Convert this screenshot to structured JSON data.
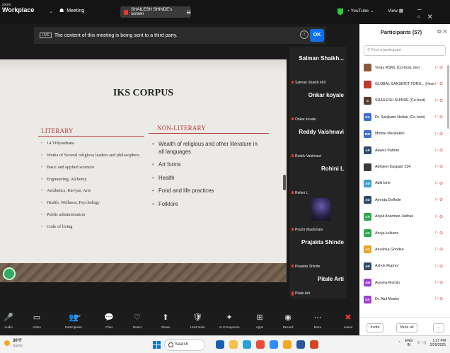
{
  "titlebar": {
    "logo_line1": "zoom",
    "logo_line2": "Workplace",
    "meeting_label": "Meeting",
    "share_label": "SHAILESH SHINDE's screen",
    "youtube_label": "YouTube",
    "view_label": "View"
  },
  "notice": {
    "badge": "LIVE",
    "text": "The content of this meeting is being sent to a third party.",
    "ok_label": "OK"
  },
  "slide": {
    "title": "IKS CORPUS",
    "literary_heading": "LITERARY",
    "literary_items": [
      "14 Vidyasthana",
      "Works of Several religious leaders and philosophers",
      "Basic and applied sciences",
      "Engineering, Alchemy",
      "Aesthetics, Kāvyas, Arts",
      "Health, Wellness, Psychology",
      "Public administration",
      "Code of living"
    ],
    "nonliterary_heading": "NON-LITERARY",
    "nonliterary_items": [
      "Wealth of religious and other literature in all languages",
      "Art forms",
      "Health",
      "Food and life practices",
      "Folklore"
    ]
  },
  "tiles": [
    {
      "name": "Salman Shaikh...",
      "sub": "Salman Shaikh 450"
    },
    {
      "name": "Onkar koyale",
      "sub": "Onkar koyale"
    },
    {
      "name": "Reddy Vaishnavi",
      "sub": "Reddy Vaishnavi"
    },
    {
      "name": "Rohini L",
      "sub": "Rohini L"
    },
    {
      "name": "",
      "sub": "Prachi Waghmare"
    },
    {
      "name": "Prajakta Shinde",
      "sub": "Prajakta Shinde"
    },
    {
      "name": "Pitale Arti",
      "sub": "Pitale Arti"
    }
  ],
  "panel": {
    "title": "Participants (57)",
    "search_placeholder": "Find a participant",
    "invite_label": "Invite",
    "muteall_label": "Mute all",
    "more_label": "...",
    "participants": [
      {
        "initials": "",
        "name": "Vinay RSML (Co-host, me)",
        "color": "#8a5a3a"
      },
      {
        "initials": "",
        "name": "GLOBAL SANSKRIT FORU... (Host)",
        "color": "#c0392b"
      },
      {
        "initials": "S",
        "name": "SHAILESH SHINDE (Co-host)",
        "color": "#5b3b2f"
      },
      {
        "initials": "DS",
        "name": "Dr. Sanjivani Nerkar (Co-host)",
        "color": "#3b6fd8"
      },
      {
        "initials": "MM",
        "name": "Mohite Mandakini",
        "color": "#3b6fd8"
      },
      {
        "initials": "AP",
        "name": "Aawez Pathan",
        "color": "#2f4a6b"
      },
      {
        "initials": "",
        "name": "Abhijeet Kaspate 234",
        "color": "#3a3a3a"
      },
      {
        "initials": "AB",
        "name": "Aditi birle",
        "color": "#3b9fd8"
      },
      {
        "initials": "AD",
        "name": "Amruta Dolfode",
        "color": "#2f4a6b"
      },
      {
        "initials": "AA",
        "name": "Anjali Anantrao Jadhav",
        "color": "#2fa84f"
      },
      {
        "initials": "AK",
        "name": "Anuja kulkarni",
        "color": "#2fa84f"
      },
      {
        "initials": "AG",
        "name": "Anushka Ghodke",
        "color": "#f0a020"
      },
      {
        "initials": "AR",
        "name": "Ashok Rupnor",
        "color": "#2f4a6b"
      },
      {
        "initials": "AM",
        "name": "Ayesha Momin",
        "color": "#9b3fd8"
      },
      {
        "initials": "DA",
        "name": "Dr. Atul Maske",
        "color": "#9b3fd8"
      }
    ]
  },
  "toolbar": {
    "buttons": [
      {
        "label": "Audio",
        "icon": "microphone-icon",
        "glyph": "🎤"
      },
      {
        "label": "Video",
        "icon": "video-icon",
        "glyph": "▭"
      },
      {
        "label": "Participants",
        "icon": "participants-icon",
        "glyph": "👥"
      },
      {
        "label": "Chat",
        "icon": "chat-icon",
        "glyph": "💬"
      },
      {
        "label": "React",
        "icon": "react-icon",
        "glyph": "♡"
      },
      {
        "label": "Share",
        "icon": "share-icon",
        "glyph": "⬆"
      },
      {
        "label": "Host tools",
        "icon": "shield-icon",
        "glyph": "🛡"
      },
      {
        "label": "AI Companion",
        "icon": "sparkle-icon",
        "glyph": "✦"
      },
      {
        "label": "Apps",
        "icon": "apps-icon",
        "glyph": "⊞"
      },
      {
        "label": "Record",
        "icon": "record-icon",
        "glyph": "◉"
      },
      {
        "label": "More",
        "icon": "more-icon",
        "glyph": "⋯"
      },
      {
        "label": "Leave",
        "icon": "leave-icon",
        "glyph": "✖"
      }
    ],
    "participants_count": "57"
  },
  "taskbar": {
    "weather_temp": "30°F",
    "weather_desc": "Sunny",
    "search_label": "Search",
    "lang": "ENG",
    "lang_sub": "IN",
    "time": "1:37 PM",
    "date": "2/25/2025"
  }
}
